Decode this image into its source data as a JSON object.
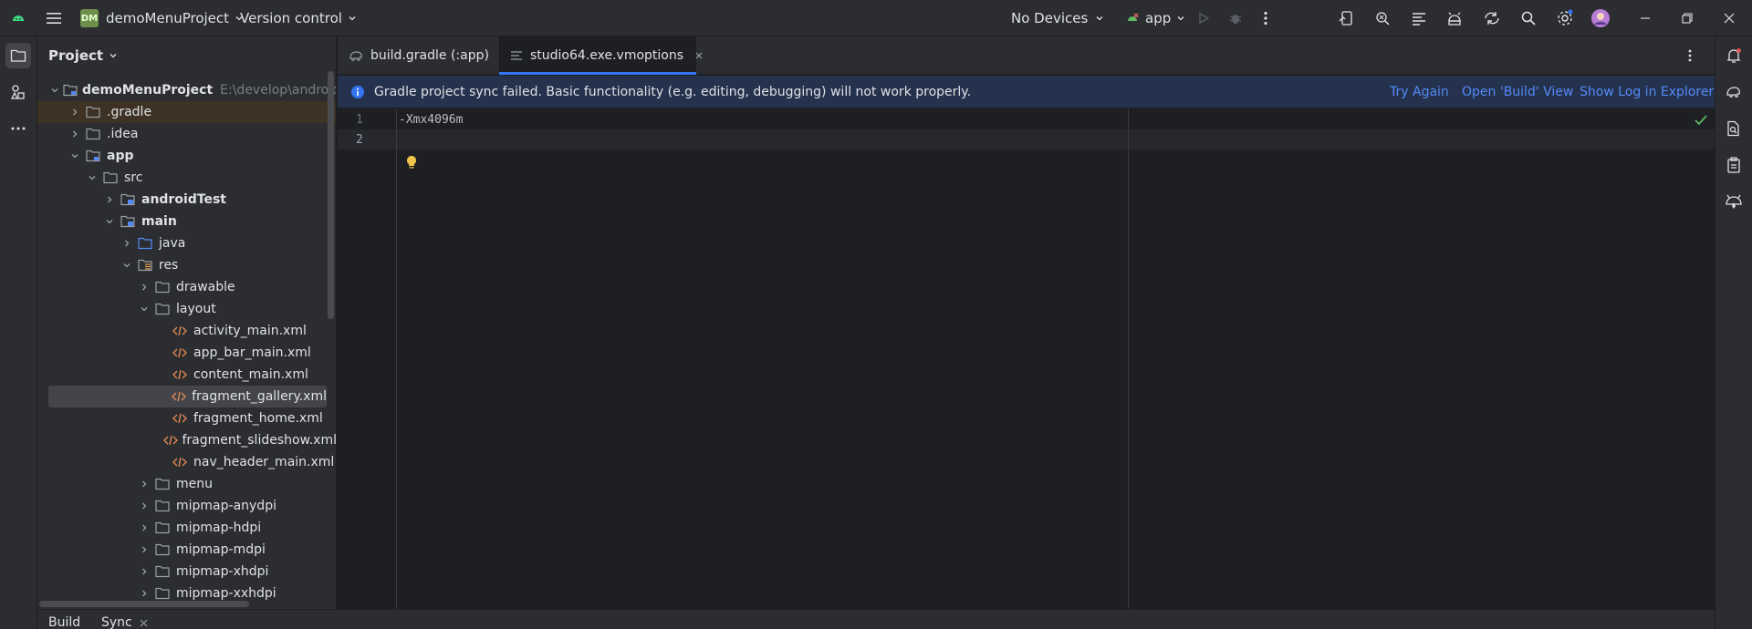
{
  "titlebar": {
    "project_badge": "DM",
    "project_name": "demoMenuProject",
    "vcs": "Version control",
    "devices": "No Devices",
    "run_config": "app"
  },
  "project_panel": {
    "title": "Project",
    "root_path": "E:\\develop\\android\\demo",
    "tree": [
      {
        "label": "demoMenuProject",
        "level": 0,
        "expanded": true,
        "icon": "module-folder-icon",
        "bold": true
      },
      {
        "label": ".gradle",
        "level": 1,
        "expanded": false,
        "icon": "folder-icon"
      },
      {
        "label": ".idea",
        "level": 1,
        "expanded": false,
        "icon": "folder-icon"
      },
      {
        "label": "app",
        "level": 1,
        "expanded": true,
        "icon": "module-folder-icon",
        "bold": true
      },
      {
        "label": "src",
        "level": 2,
        "expanded": true,
        "icon": "folder-icon"
      },
      {
        "label": "androidTest",
        "level": 3,
        "expanded": false,
        "icon": "source-folder-icon",
        "bold": true
      },
      {
        "label": "main",
        "level": 3,
        "expanded": true,
        "icon": "source-folder-icon",
        "bold": true
      },
      {
        "label": "java",
        "level": 4,
        "expanded": false,
        "icon": "java-folder-icon"
      },
      {
        "label": "res",
        "level": 4,
        "expanded": true,
        "icon": "res-folder-icon"
      },
      {
        "label": "drawable",
        "level": 5,
        "expanded": false,
        "icon": "folder-icon"
      },
      {
        "label": "layout",
        "level": 5,
        "expanded": true,
        "icon": "folder-icon"
      },
      {
        "label": "activity_main.xml",
        "level": 6,
        "icon": "xml-file-icon"
      },
      {
        "label": "app_bar_main.xml",
        "level": 6,
        "icon": "xml-file-icon"
      },
      {
        "label": "content_main.xml",
        "level": 6,
        "icon": "xml-file-icon"
      },
      {
        "label": "fragment_gallery.xml",
        "level": 6,
        "icon": "xml-file-icon",
        "selected": true
      },
      {
        "label": "fragment_home.xml",
        "level": 6,
        "icon": "xml-file-icon"
      },
      {
        "label": "fragment_slideshow.xml",
        "level": 6,
        "icon": "xml-file-icon"
      },
      {
        "label": "nav_header_main.xml",
        "level": 6,
        "icon": "xml-file-icon"
      },
      {
        "label": "menu",
        "level": 5,
        "expanded": false,
        "icon": "folder-icon"
      },
      {
        "label": "mipmap-anydpi",
        "level": 5,
        "expanded": false,
        "icon": "folder-icon"
      },
      {
        "label": "mipmap-hdpi",
        "level": 5,
        "expanded": false,
        "icon": "folder-icon"
      },
      {
        "label": "mipmap-mdpi",
        "level": 5,
        "expanded": false,
        "icon": "folder-icon"
      },
      {
        "label": "mipmap-xhdpi",
        "level": 5,
        "expanded": false,
        "icon": "folder-icon"
      },
      {
        "label": "mipmap-xxhdpi",
        "level": 5,
        "expanded": false,
        "icon": "folder-icon"
      }
    ]
  },
  "editor": {
    "tabs": [
      {
        "label": "build.gradle (:app)",
        "active": false
      },
      {
        "label": "studio64.exe.vmoptions",
        "active": true
      }
    ],
    "banner": {
      "message": "Gradle project sync failed. Basic functionality (e.g. editing, debugging) will not work properly.",
      "actions": [
        "Try Again",
        "Open 'Build' View",
        "Show Log in Explorer"
      ]
    },
    "lines": [
      {
        "number": "1",
        "text": "-Xmx4096m"
      },
      {
        "number": "2",
        "text": ""
      }
    ]
  },
  "bottom": {
    "tabs": [
      "Build",
      "Sync"
    ]
  },
  "colors": {
    "accent": "#3574f0",
    "link": "#548af7",
    "banner_bg": "#25324d",
    "xml_icon": "#e08855",
    "folder": "#9aa0a6",
    "check": "#5fb865"
  }
}
